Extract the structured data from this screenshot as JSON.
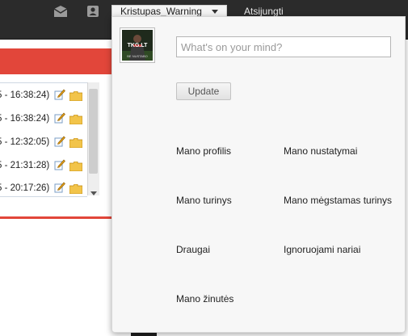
{
  "topbar": {
    "username": "Kristupas_Warning",
    "logout_label": "Atsijungti"
  },
  "background": {
    "rows": [
      {
        "timestamp": "5 - 16:38:24)"
      },
      {
        "timestamp": "5 - 16:38:24)"
      },
      {
        "timestamp": "5 - 12:32:05)"
      },
      {
        "timestamp": "5 - 21:31:28)"
      },
      {
        "timestamp": "5 - 20:17:26)"
      }
    ]
  },
  "panel": {
    "avatar_text": "TKG.LT",
    "avatar_tagline": "BE NUSTABO",
    "status_placeholder": "What's on your mind?",
    "update_label": "Update",
    "links": {
      "profile": "Mano profilis",
      "settings": "Mano nustatymai",
      "content": "Mano turinys",
      "favorites": "Mano mėgstamas turinys",
      "friends": "Draugai",
      "ignored": "Ignoruojami nariai",
      "messages": "Mano žinutės"
    }
  },
  "colors": {
    "accent_red": "#e2463a",
    "topbar": "#2b2b2b"
  }
}
